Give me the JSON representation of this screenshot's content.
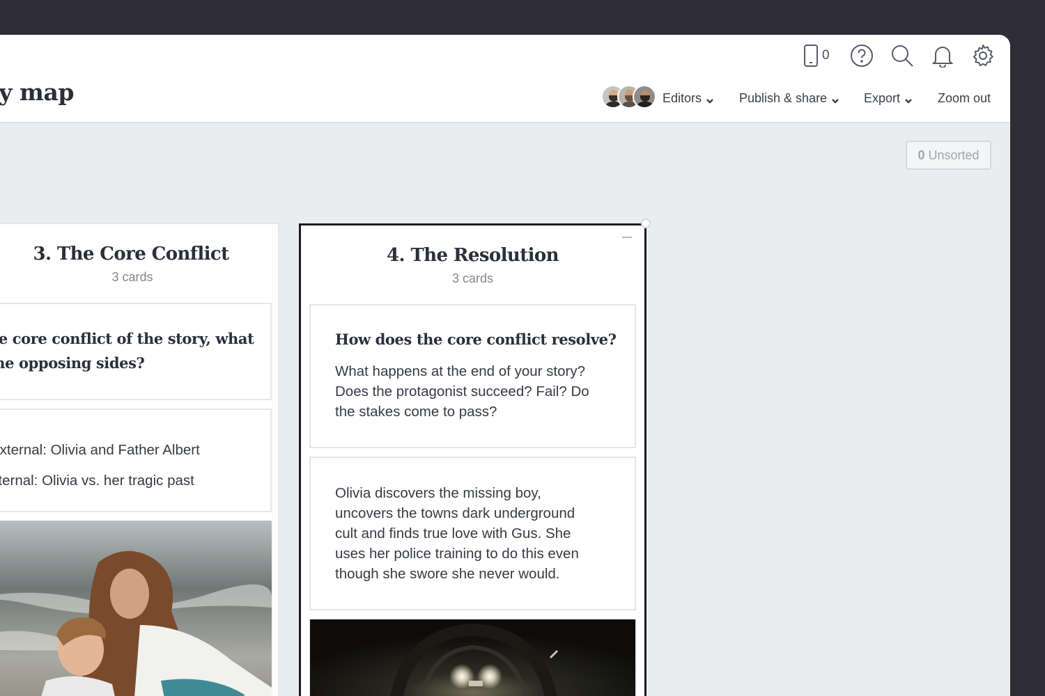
{
  "header": {
    "title": "ory map",
    "phone_count": "0",
    "icons": [
      "mobile-icon",
      "help-icon",
      "search-icon",
      "bell-icon",
      "gear-icon"
    ],
    "menu": {
      "editors": "Editors",
      "publish": "Publish & share",
      "export": "Export",
      "zoom": "Zoom out"
    }
  },
  "unsorted": {
    "count": "0",
    "label": "Unsorted"
  },
  "columns": [
    {
      "title": "3. The Core Conflict",
      "count": "3 cards",
      "cards": [
        {
          "question_line1": "he core conflict of the story, what",
          "question_line2": "the opposing sides?"
        },
        {
          "line1": "External: Olivia and Father Albert",
          "line2": "nternal: Olivia vs. her tragic past"
        },
        {
          "image": "photo-mother-and-child-at-sea"
        }
      ]
    },
    {
      "title": "4. The Resolution",
      "count": "3 cards",
      "cards": [
        {
          "question": "How does the core conflict resolve?",
          "body_lines": [
            "What happens at the end of your story?",
            "Does the protagonist succeed? Fail? Do",
            "the stakes come to pass?"
          ]
        },
        {
          "body_lines": [
            "Olivia discovers the missing boy,",
            "uncovers the towns dark underground",
            "cult and finds true love with Gus. She",
            "uses her police training to do this even",
            "though she swore she never would."
          ]
        },
        {
          "image": "photo-dark-tunnel-with-train-lights"
        }
      ]
    }
  ],
  "colors": {
    "background": "#2e2d37",
    "canvas": "#ebecee",
    "text": "#2b2f3b",
    "selected_border": "#1b1c20"
  }
}
